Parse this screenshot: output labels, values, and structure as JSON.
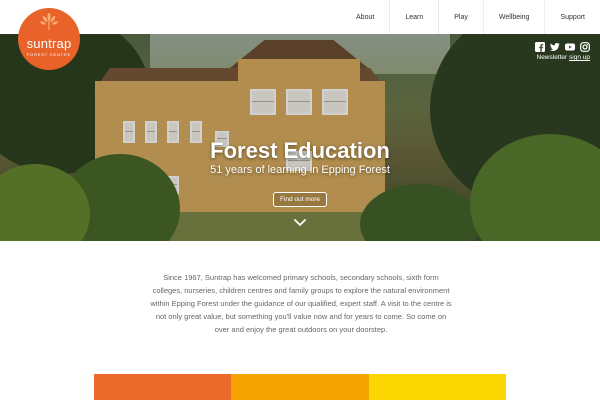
{
  "header": {
    "nav": [
      "About",
      "Learn",
      "Play",
      "Wellbeing",
      "Support"
    ]
  },
  "logo": {
    "name": "suntrap",
    "subtitle": "FOREST CENTRE",
    "color": "#e8622a"
  },
  "hero": {
    "title": "Forest Education",
    "subtitle": "51 years of learning in Epping Forest",
    "button_label": "Find out more",
    "social_icons": [
      "facebook-icon",
      "twitter-icon",
      "youtube-icon",
      "instagram-icon"
    ],
    "newsletter_label": "Newsletter",
    "newsletter_link": "sign up"
  },
  "intro": {
    "text": "Since 1967, Suntrap has welcomed primary schools, secondary schools, sixth form colleges, nurseries, children centres and family groups to explore the natural environment within Epping Forest under the guidance of our qualified, expert staff. A visit to the centre is not only great value, but something you'll value now and for years to come. So come on over and enjoy the great outdoors on your doorstep."
  },
  "color_bar": [
    "#ec6a2c",
    "#f5a300",
    "#fbd600"
  ]
}
